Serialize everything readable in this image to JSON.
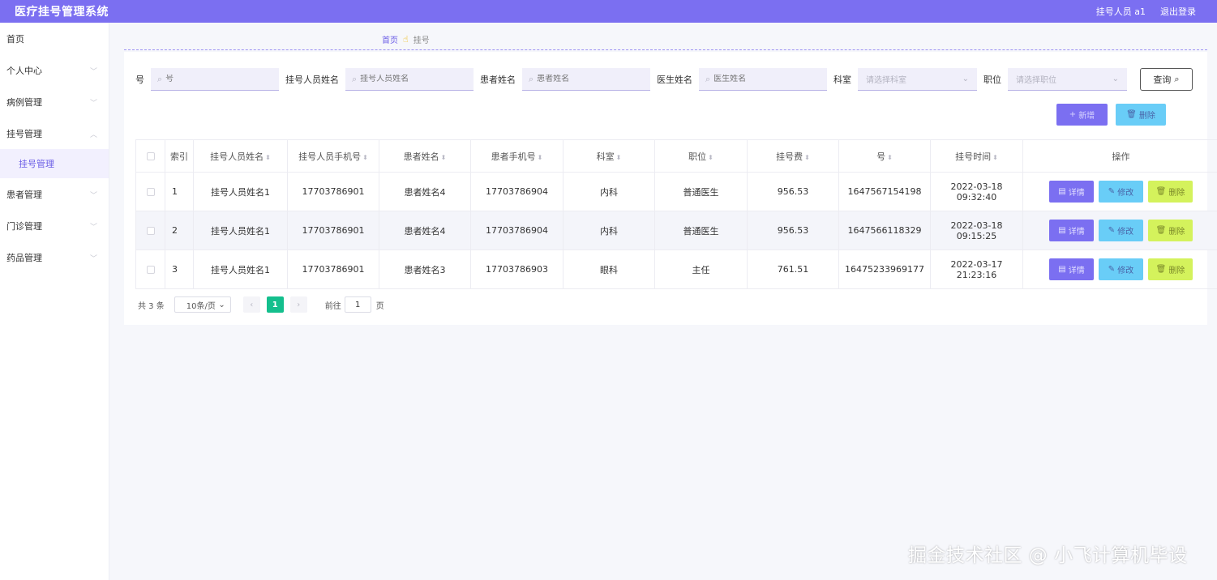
{
  "header": {
    "title": "医疗挂号管理系统",
    "user": "挂号人员 a1",
    "logout": "退出登录"
  },
  "sidebar": {
    "items": [
      {
        "label": "首页",
        "chevron": ""
      },
      {
        "label": "个人中心",
        "chevron": "﹀"
      },
      {
        "label": "病例管理",
        "chevron": "﹀"
      },
      {
        "label": "挂号管理",
        "chevron": "︿"
      },
      {
        "label": "患者管理",
        "chevron": "﹀"
      },
      {
        "label": "门诊管理",
        "chevron": "﹀"
      },
      {
        "label": "药品管理",
        "chevron": "﹀"
      }
    ],
    "submenu": "挂号管理"
  },
  "breadcrumb": {
    "home": "首页",
    "separator": "☝",
    "current": "挂号"
  },
  "search": {
    "fields": [
      {
        "label": "号",
        "placeholder": "号"
      },
      {
        "label": "挂号人员姓名",
        "placeholder": "挂号人员姓名"
      },
      {
        "label": "患者姓名",
        "placeholder": "患者姓名"
      },
      {
        "label": "医生姓名",
        "placeholder": "医生姓名"
      }
    ],
    "selects": [
      {
        "label": "科室",
        "placeholder": "请选择科室"
      },
      {
        "label": "职位",
        "placeholder": "请选择职位"
      }
    ],
    "query_label": "查询"
  },
  "toolbar": {
    "add_label": "新增",
    "delete_label": "删除"
  },
  "table": {
    "headers": [
      "索引",
      "挂号人员姓名",
      "挂号人员手机号",
      "患者姓名",
      "患者手机号",
      "科室",
      "职位",
      "挂号费",
      "号",
      "挂号时间",
      "操作"
    ],
    "rows": [
      [
        "1",
        "挂号人员姓名1",
        "17703786901",
        "患者姓名4",
        "17703786904",
        "内科",
        "普通医生",
        "956.53",
        "1647567154198",
        "2022-03-18 09:32:40"
      ],
      [
        "2",
        "挂号人员姓名1",
        "17703786901",
        "患者姓名4",
        "17703786904",
        "内科",
        "普通医生",
        "956.53",
        "1647566118329",
        "2022-03-18 09:15:25"
      ],
      [
        "3",
        "挂号人员姓名1",
        "17703786901",
        "患者姓名3",
        "17703786903",
        "眼科",
        "主任",
        "761.51",
        "16475233969177",
        "2022-03-17 21:23:16"
      ]
    ],
    "actions": {
      "detail": "详情",
      "edit": "修改",
      "delete": "删除"
    }
  },
  "pagination": {
    "total": "共 3 条",
    "page_size": "10条/页",
    "current_page": "1",
    "goto_label": "前往",
    "goto_value": "1",
    "page_unit": "页"
  },
  "watermark": "掘金技术社区 @ 小飞计算机毕设",
  "colors": {
    "header": "#7b6ff1",
    "primary": "#7b6ff1",
    "info": "#69cdf7",
    "warning": "#d4f25c",
    "pager_active": "#14bf8d"
  }
}
